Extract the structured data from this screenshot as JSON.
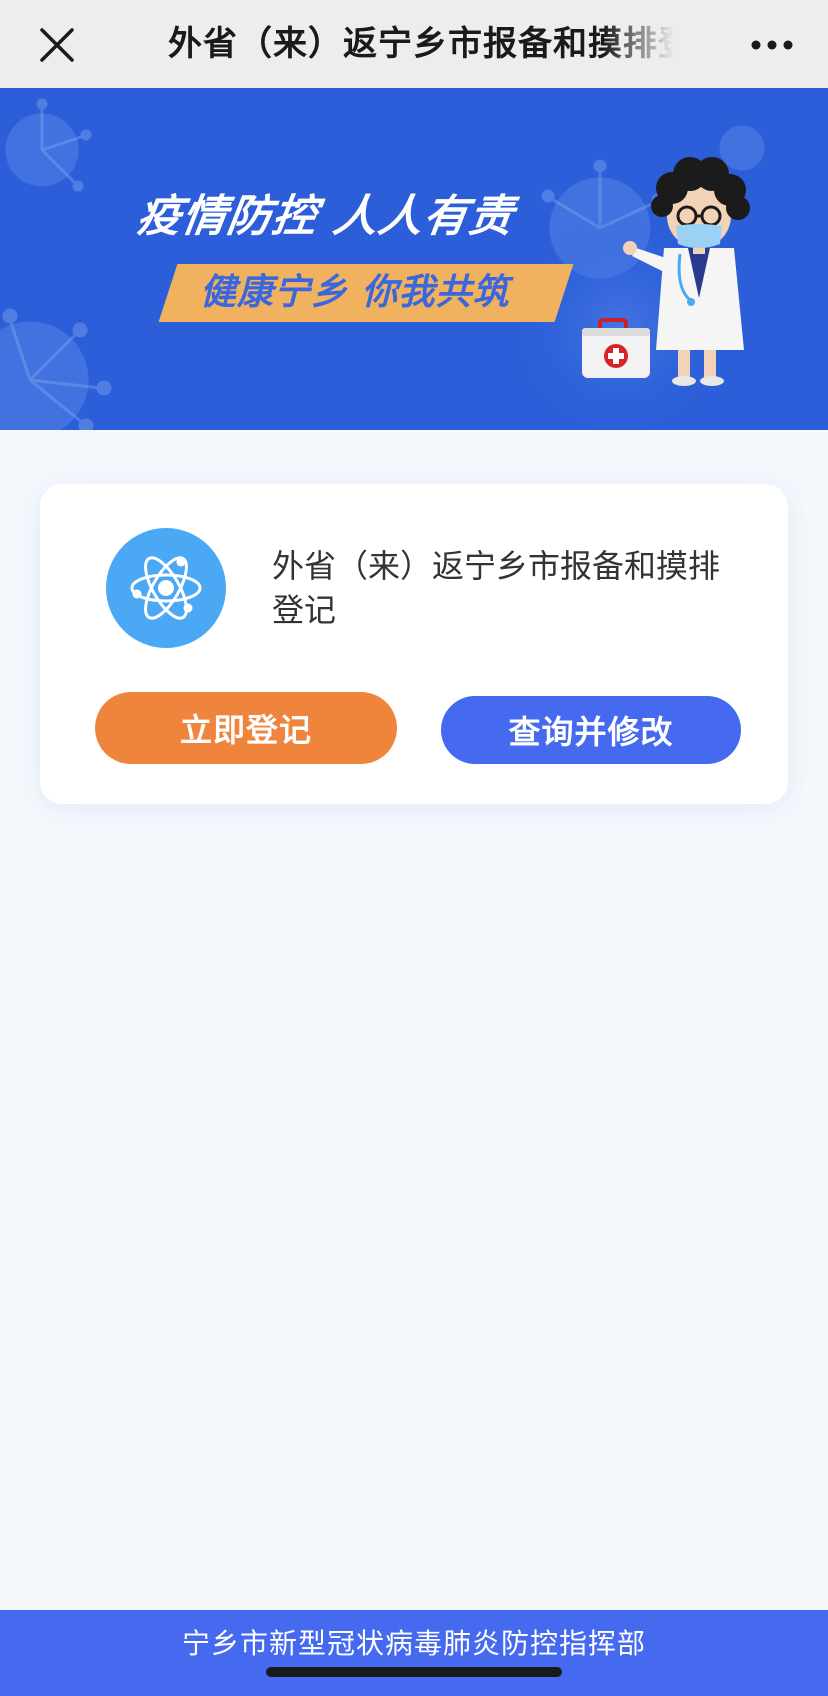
{
  "topbar": {
    "title": "外省（来）返宁乡市报备和摸排登记",
    "close_icon": "close-icon",
    "more_icon": "more-horizontal-icon"
  },
  "banner": {
    "slogan_primary": "疫情防控  人人有责",
    "slogan_secondary": "健康宁乡  你我共筑",
    "colors": {
      "background": "#2b5ed8",
      "ribbon": "#f0b25e",
      "ribbon_text": "#3a67dd"
    },
    "illustration": "doctor-with-mask-and-first-aid-kit"
  },
  "card": {
    "icon": "atom-icon",
    "title": "外省（来）返宁乡市报备和摸排登记",
    "register_button": "立即登记",
    "query_button": "查询并修改"
  },
  "footer": {
    "text": "宁乡市新型冠状病毒肺炎防控指挥部"
  },
  "colors": {
    "accent_orange": "#ef843c",
    "accent_blue": "#4569ef",
    "icon_blue": "#4aa8f4",
    "page_background": "#f5f8fd"
  }
}
